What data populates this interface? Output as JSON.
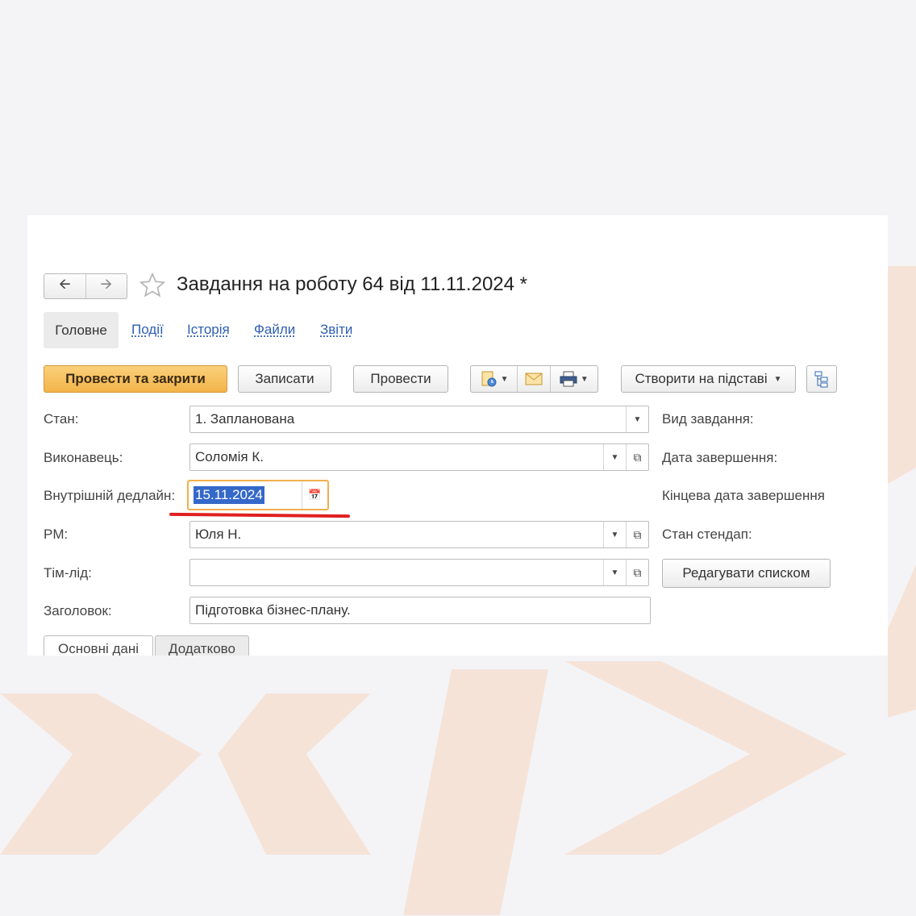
{
  "window": {
    "title": "Завдання на роботу 64 від 11.11.2024 *",
    "nav": {
      "back_icon": "arrow-left-icon",
      "forward_icon": "arrow-right-icon"
    }
  },
  "tabs": {
    "main": "Головне",
    "links": [
      "Події",
      "Історія",
      "Файли",
      "Звіти"
    ]
  },
  "toolbar": {
    "post_and_close": "Провести та закрити",
    "save": "Записати",
    "post": "Провести",
    "create_based_on": "Створити на підставі",
    "icons": [
      "document-clock-icon",
      "mail-icon",
      "print-icon",
      "structure-icon"
    ]
  },
  "form": {
    "state": {
      "label": "Стан:",
      "value": "1. Запланована"
    },
    "assignee": {
      "label": "Виконавець:",
      "value": "Соломія К."
    },
    "internal_deadline": {
      "label": "Внутрішній дедлайн:",
      "value": "15.11.2024"
    },
    "pm": {
      "label": "PM:",
      "value": "Юля Н."
    },
    "team_lead": {
      "label": "Тім-лід:",
      "value": ""
    },
    "heading": {
      "label": "Заголовок:",
      "value": "Підготовка бізнес-плану."
    }
  },
  "right_column": {
    "task_type": "Вид завдання:",
    "completion_date": "Дата завершення:",
    "final_completion_date": "Кінцева дата завершення",
    "standup_state": "Стан стендап:",
    "edit_list_button": "Редагувати списком"
  },
  "bottom_tabs": [
    "Основні дані",
    "Додатково"
  ],
  "colors": {
    "primary_button": "#f2b44a",
    "link": "#2e5fb3",
    "selection": "#3468c9",
    "highlight_border": "#f1b04d",
    "annotation_line": "#e02020",
    "decoration": "#f6e3d8"
  }
}
